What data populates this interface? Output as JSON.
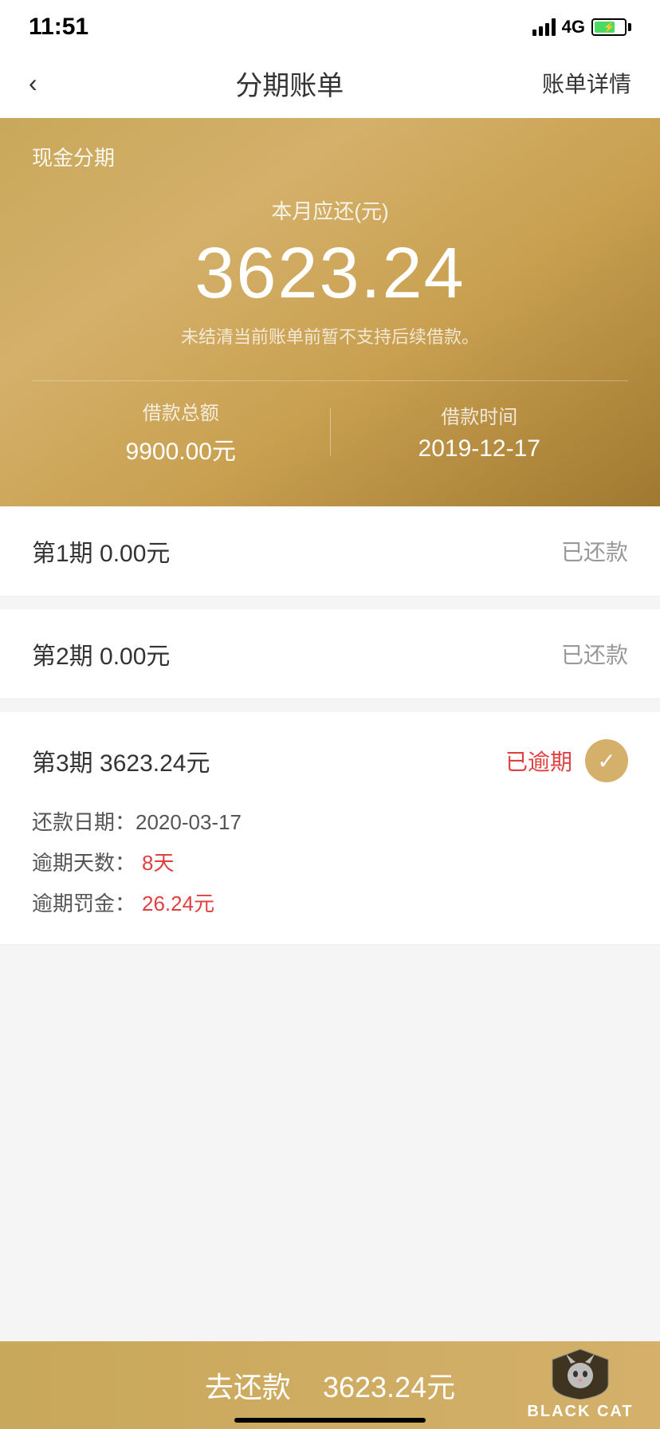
{
  "statusBar": {
    "time": "11:51",
    "network": "4G"
  },
  "navBar": {
    "back": "‹",
    "title": "分期账单",
    "action": "账单详情"
  },
  "header": {
    "category": "现金分期",
    "amountLabel": "本月应还(元)",
    "amount": "3623.24",
    "notice": "未结清当前账单前暂不支持后续借款。",
    "loanTotalLabel": "借款总额",
    "loanTotalValue": "9900.00元",
    "loanDateLabel": "借款时间",
    "loanDateValue": "2019-12-17"
  },
  "periods": [
    {
      "label": "第1期  0.00元",
      "status": "已还款",
      "overdue": false
    },
    {
      "label": "第2期  0.00元",
      "status": "已还款",
      "overdue": false
    },
    {
      "label": "第3期  3623.24元",
      "status": "已逾期",
      "overdue": true,
      "repayDate": "还款日期：2020-03-17",
      "overdueDaysLabel": "逾期天数：",
      "overdueDaysValue": "8天",
      "overdueFineLabel": "逾期罚金：",
      "overdueFineValue": "26.24元"
    }
  ],
  "bottomBar": {
    "label": "去还款",
    "amount": "3623.24元"
  },
  "blackCat": {
    "text": "BLACK CAT"
  }
}
